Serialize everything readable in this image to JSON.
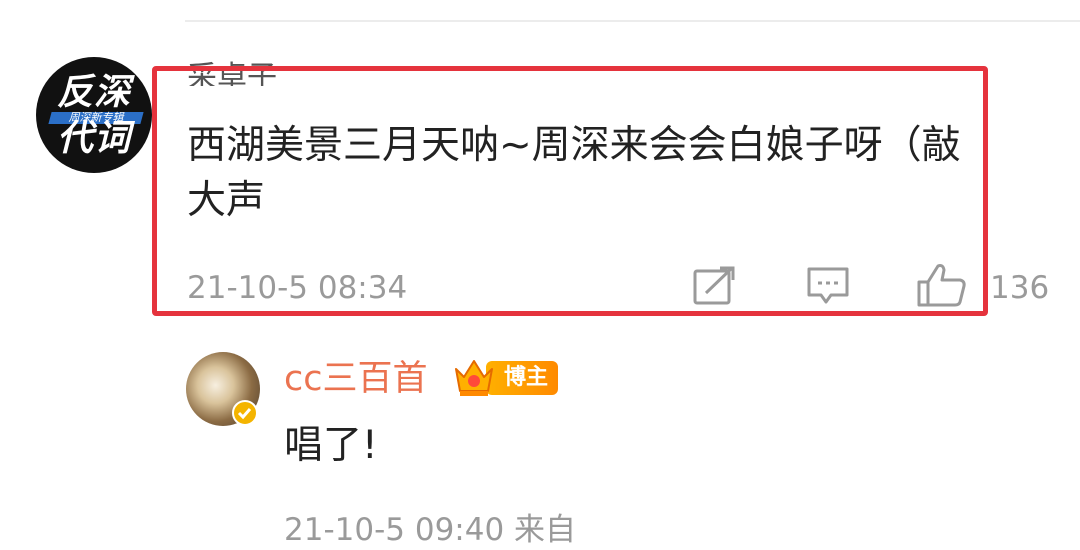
{
  "main_comment": {
    "avatar_text_line1": "反深",
    "avatar_text_line2": "代词",
    "avatar_subtext": "周深新专辑",
    "username": "采卓子",
    "text": "西湖美景三月天呐~周深来会会白娘子呀（敲大声",
    "timestamp": "21-10-5 08:34",
    "like_count": "136",
    "icons": [
      "share-icon",
      "comment-icon",
      "like-icon"
    ]
  },
  "reply": {
    "username": "cc三百首",
    "badge": "博主",
    "text": "唱了!",
    "footer": "21-10-5 09:40  来自"
  },
  "colors": {
    "highlight": "#e5333d",
    "username_reply": "#eb7350",
    "badge": "#ff9c00",
    "meta_gray": "#9a9a9a"
  }
}
